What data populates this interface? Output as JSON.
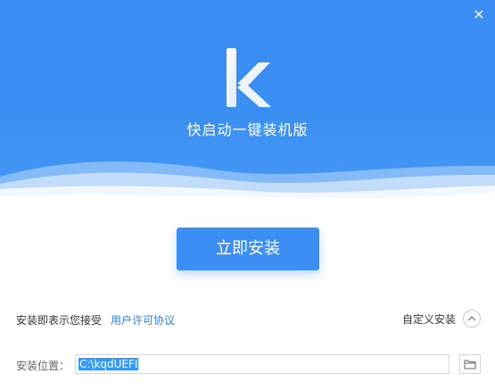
{
  "window": {
    "close_label": "×",
    "app_title": "快启动一键装机版"
  },
  "main": {
    "install_button": "立即安装"
  },
  "agreement": {
    "prefix": "安装即表示您接受",
    "link": "用户许可协议"
  },
  "custom_install": {
    "label": "自定义安装"
  },
  "location": {
    "label": "安装位置：",
    "value": "C:\\kqdUEFI"
  },
  "icons": {
    "close": "close-icon",
    "logo": "k-logo-icon",
    "chevron": "chevron-up-icon",
    "folder": "folder-icon"
  },
  "colors": {
    "brand_blue": "#3b8ef4",
    "link_blue": "#2d7fe0",
    "selection": "#3399ff"
  }
}
